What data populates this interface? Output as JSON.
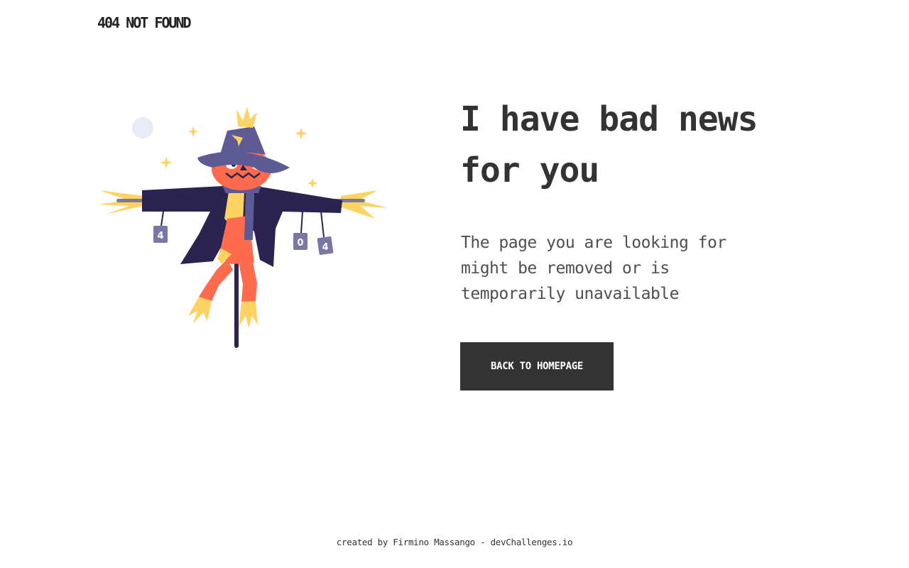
{
  "header": {
    "brand": "404 NOT FOUND"
  },
  "illustration": {
    "subject": "scarecrow-icon",
    "can_labels": [
      "4",
      "0",
      "4"
    ]
  },
  "main": {
    "headline": "I have bad news for you",
    "description": "The page you are looking for might be removed or is temporarily unavailable",
    "button_label": "BACK TO HOMEPAGE"
  },
  "footer": {
    "credit": "created by Firmino Massango - devChallenges.io"
  },
  "colors": {
    "text": "#333333",
    "button_bg": "#333333",
    "button_text": "#ffffff",
    "hat": "#5e5a96",
    "coat": "#2b2350",
    "pumpkin": "#ff6b4d",
    "straw": "#ffd363",
    "moon": "#e8ecf6",
    "can": "#7a76a6"
  }
}
